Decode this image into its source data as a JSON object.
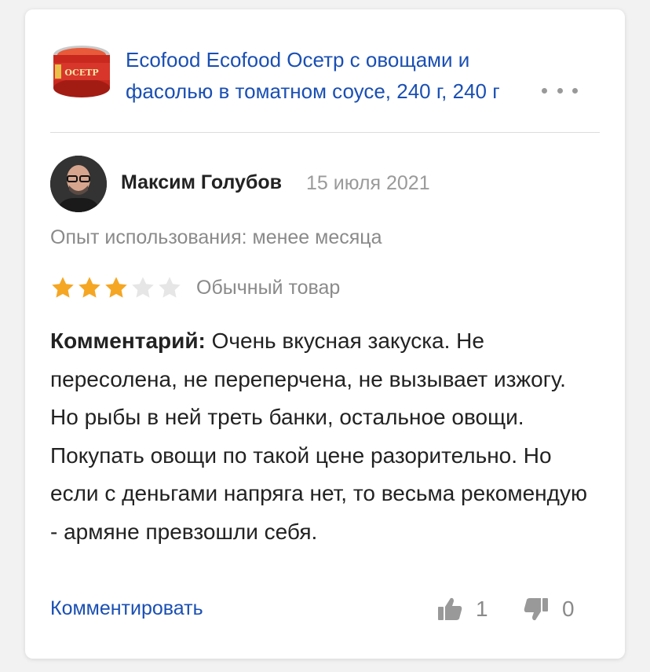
{
  "product": {
    "title": "Ecofood Ecofood Осетр с овощами и фасолью в томатном соусе, 240 г, 240 г",
    "image_label": "ОСЕТР"
  },
  "review": {
    "author": "Максим Голубов",
    "date": "15 июля 2021",
    "experience": "Опыт использования: менее месяца",
    "rating": 3,
    "rating_max": 5,
    "rating_label": "Обычный товар",
    "comment_label": "Комментарий:",
    "comment_text": "Очень вкусная закуска. Не пересолена, не переперчена, не вызывает изжогу. Но рыбы в ней треть банки, остальное овощи. Покупать овощи по такой цене разорительно. Но если с деньгами напряга нет, то весьма рекомендую - армяне превзошли себя."
  },
  "actions": {
    "reply_label": "Комментировать",
    "likes": "1",
    "dislikes": "0"
  },
  "colors": {
    "link": "#1a4fb3",
    "star_active": "#f5a623",
    "star_inactive": "#e6e6e6",
    "muted": "#8a8a8a"
  }
}
